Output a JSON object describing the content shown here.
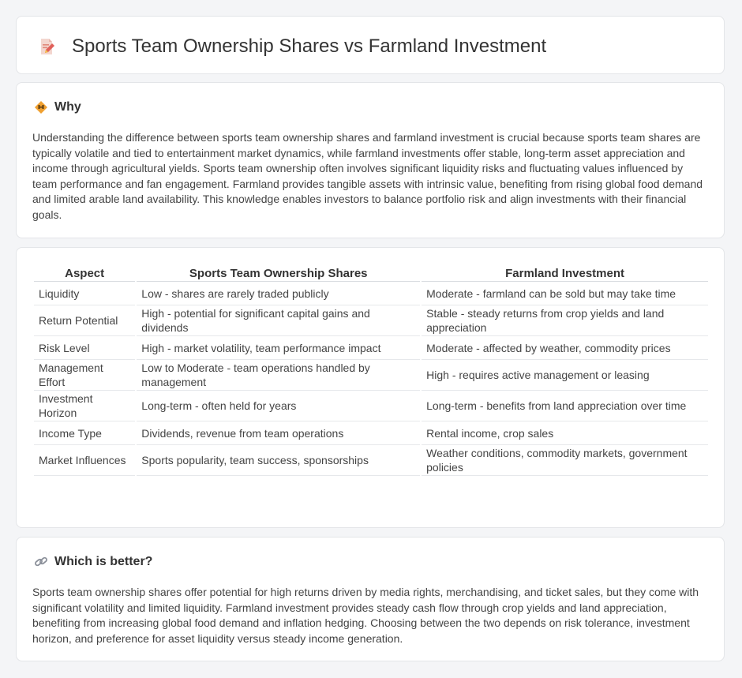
{
  "header": {
    "title": "Sports Team Ownership Shares vs Farmland Investment"
  },
  "why": {
    "title": "Why",
    "body": "Understanding the difference between sports team ownership shares and farmland investment is crucial because sports team shares are typically volatile and tied to entertainment market dynamics, while farmland investments offer stable, long-term asset appreciation and income through agricultural yields. Sports team ownership often involves significant liquidity risks and fluctuating values influenced by team performance and fan engagement. Farmland provides tangible assets with intrinsic value, benefiting from rising global food demand and limited arable land availability. This knowledge enables investors to balance portfolio risk and align investments with their financial goals."
  },
  "table": {
    "headers": [
      "Aspect",
      "Sports Team Ownership Shares",
      "Farmland Investment"
    ],
    "rows": [
      [
        "Liquidity",
        "Low - shares are rarely traded publicly",
        "Moderate - farmland can be sold but may take time"
      ],
      [
        "Return Potential",
        "High - potential for significant capital gains and dividends",
        "Stable - steady returns from crop yields and land appreciation"
      ],
      [
        "Risk Level",
        "High - market volatility, team performance impact",
        "Moderate - affected by weather, commodity prices"
      ],
      [
        "Management Effort",
        "Low to Moderate - team operations handled by management",
        "High - requires active management or leasing"
      ],
      [
        "Investment Horizon",
        "Long-term - often held for years",
        "Long-term - benefits from land appreciation over time"
      ],
      [
        "Income Type",
        "Dividends, revenue from team operations",
        "Rental income, crop sales"
      ],
      [
        "Market Influences",
        "Sports popularity, team success, sponsorships",
        "Weather conditions, commodity markets, government policies"
      ]
    ]
  },
  "better": {
    "title": "Which is better?",
    "body": "Sports team ownership shares offer potential for high returns driven by media rights, merchandising, and ticket sales, but they come with significant volatility and limited liquidity. Farmland investment provides steady cash flow through crop yields and land appreciation, benefiting from increasing global food demand and inflation hedging. Choosing between the two depends on risk tolerance, investment horizon, and preference for asset liquidity versus steady income generation."
  },
  "icons": {
    "header": "document-pencil-icon",
    "why": "warning-diamond-icon",
    "better": "link-icon"
  },
  "colors": {
    "accent": "#f0a030",
    "icon_red": "#e0605a",
    "link_gray": "#8a8f99"
  }
}
